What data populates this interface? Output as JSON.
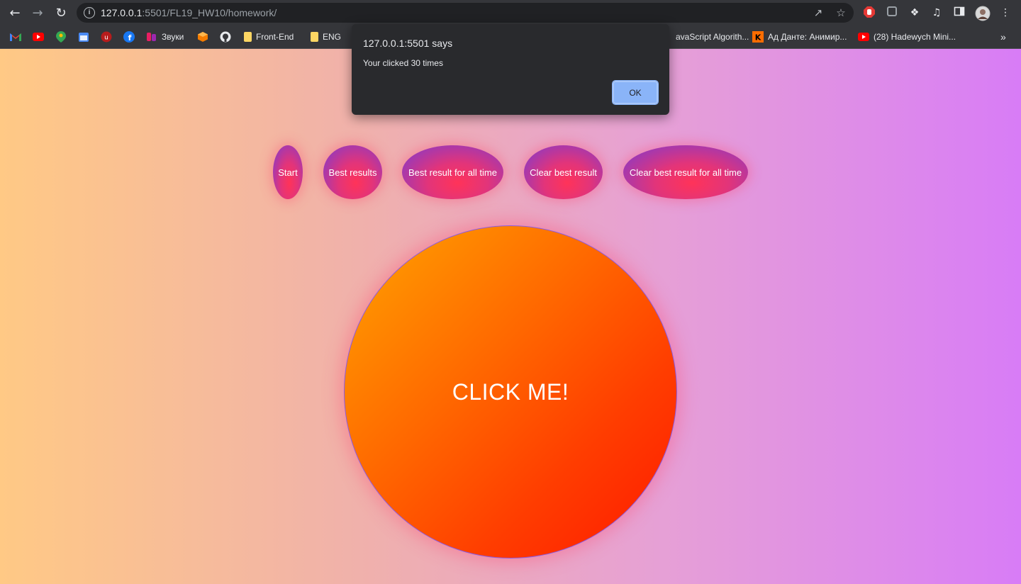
{
  "browser": {
    "url_host": "127.0.0.1",
    "url_rest": ":5501/FL19_HW10/homework/",
    "icons": {
      "back": "arrow-left-icon",
      "forward": "arrow-right-icon",
      "reload": "reload-icon",
      "info": "info-icon",
      "share": "share-icon",
      "star": "star-icon",
      "extensions": "puzzle-icon",
      "menu": "kebab-menu-icon"
    }
  },
  "bookmarks": {
    "items": [
      {
        "label": ""
      },
      {
        "label": ""
      },
      {
        "label": ""
      },
      {
        "label": ""
      },
      {
        "label": ""
      },
      {
        "label": ""
      },
      {
        "label": "Звуки"
      },
      {
        "label": ""
      },
      {
        "label": ""
      },
      {
        "label": "Front-End"
      },
      {
        "label": "ENG"
      },
      {
        "label": "avaScript Algorith..."
      },
      {
        "label": "Ад Данте: Анимир..."
      },
      {
        "label": "(28) Hadewych Mini..."
      }
    ],
    "overflow": "»"
  },
  "page": {
    "buttons": [
      {
        "label": "Start"
      },
      {
        "label": "Best results"
      },
      {
        "label": "Best result for all time"
      },
      {
        "label": "Clear best result"
      },
      {
        "label": "Clear best result for all time"
      }
    ],
    "click_label": "CLICK ME!",
    "colors": {
      "bg_left": "#ffc985",
      "bg_right": "#d87cf6",
      "circle_start": "#ffa400",
      "circle_end": "#ff1800",
      "pill_center": "#ff3359",
      "pill_edge": "#7a3bd2"
    }
  },
  "alert": {
    "title": "127.0.0.1:5501 says",
    "message": "Your clicked 30 times",
    "ok_label": "OK"
  }
}
